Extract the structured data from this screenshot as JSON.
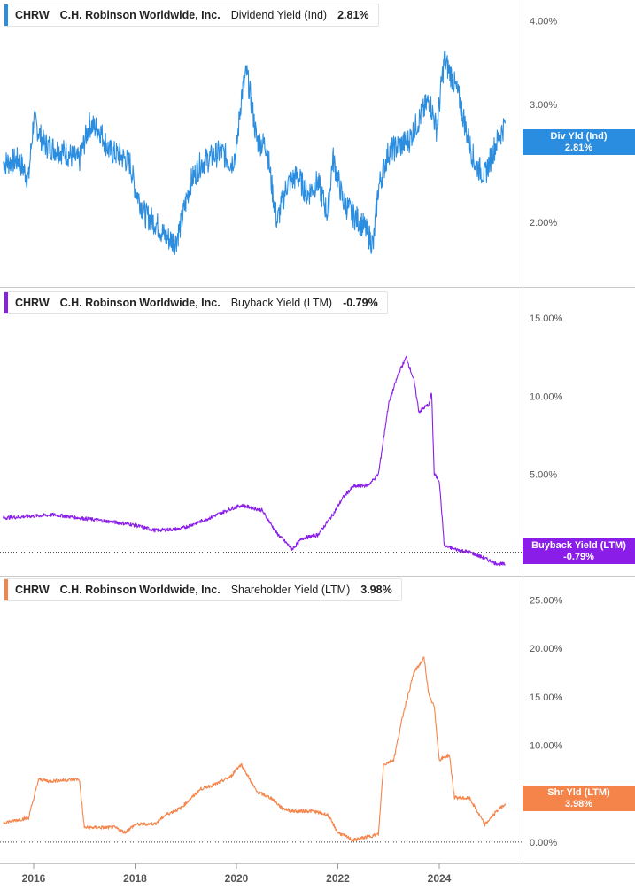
{
  "x_axis": {
    "ticks": [
      "2016",
      "2018",
      "2020",
      "2022",
      "2024"
    ]
  },
  "panels": [
    {
      "ticker": "CHRW",
      "company": "C.H. Robinson Worldwide, Inc.",
      "metric": "Dividend Yield (Ind)",
      "value_label": "2.81%",
      "callout_line1": "Div Yld (Ind)",
      "callout_line2": "2.81%",
      "y_ticks": [
        "4.00%",
        "3.00%",
        "2.00%"
      ],
      "color": "#2a8de0"
    },
    {
      "ticker": "CHRW",
      "company": "C.H. Robinson Worldwide, Inc.",
      "metric": "Buyback Yield (LTM)",
      "value_label": "-0.79%",
      "callout_line1": "Buyback Yield (LTM)",
      "callout_line2": "-0.79%",
      "y_ticks": [
        "15.00%",
        "10.00%",
        "5.00%",
        "0.00%"
      ],
      "color": "#8a1ee8"
    },
    {
      "ticker": "CHRW",
      "company": "C.H. Robinson Worldwide, Inc.",
      "metric": "Shareholder Yield (LTM)",
      "value_label": "3.98%",
      "callout_line1": "Shr Yld (LTM)",
      "callout_line2": "3.98%",
      "y_ticks": [
        "25.00%",
        "20.00%",
        "15.00%",
        "10.00%",
        "5.00%",
        "0.00%"
      ],
      "color": "#f5844a"
    }
  ],
  "chart_data": [
    {
      "type": "line",
      "title": "Dividend Yield (Ind)",
      "series": [
        {
          "name": "CHRW C.H. Robinson Worldwide, Inc.",
          "x": [
            2015.4,
            2015.7,
            2015.9,
            2016.0,
            2016.2,
            2016.4,
            2016.6,
            2016.9,
            2017.1,
            2017.3,
            2017.5,
            2017.7,
            2017.9,
            2018.0,
            2018.2,
            2018.4,
            2018.6,
            2018.8,
            2018.9,
            2019.1,
            2019.3,
            2019.5,
            2019.7,
            2019.9,
            2020.0,
            2020.1,
            2020.2,
            2020.4,
            2020.6,
            2020.7,
            2020.8,
            2021.0,
            2021.2,
            2021.4,
            2021.6,
            2021.8,
            2021.9,
            2022.1,
            2022.3,
            2022.5,
            2022.7,
            2022.8,
            2023.0,
            2023.2,
            2023.4,
            2023.6,
            2023.8,
            2023.95,
            2024.1,
            2024.25,
            2024.4,
            2024.55,
            2024.7,
            2024.9,
            2025.1,
            2025.3
          ],
          "y": [
            2.45,
            2.48,
            2.32,
            2.85,
            2.62,
            2.58,
            2.55,
            2.47,
            2.8,
            2.75,
            2.55,
            2.52,
            2.45,
            2.25,
            2.05,
            2.0,
            1.9,
            1.87,
            1.98,
            2.3,
            2.45,
            2.5,
            2.55,
            2.45,
            2.55,
            3.1,
            3.35,
            2.65,
            2.6,
            2.25,
            2.0,
            2.28,
            2.35,
            2.2,
            2.3,
            2.05,
            2.5,
            2.15,
            2.05,
            1.98,
            1.85,
            2.25,
            2.55,
            2.6,
            2.65,
            2.85,
            3.05,
            2.75,
            3.5,
            3.3,
            3.05,
            2.7,
            2.45,
            2.35,
            2.6,
            2.81
          ]
        }
      ],
      "ylim": [
        1.6,
        4.3
      ],
      "yscale": "log",
      "x_ticks": [
        "2016",
        "2018",
        "2020",
        "2022",
        "2024"
      ],
      "y_ticks": [
        "4.00%",
        "3.00%",
        "2.00%"
      ]
    },
    {
      "type": "line",
      "title": "Buyback Yield (LTM)",
      "series": [
        {
          "name": "CHRW C.H. Robinson Worldwide, Inc.",
          "x": [
            2015.4,
            2015.9,
            2016.4,
            2016.9,
            2017.4,
            2017.9,
            2018.4,
            2018.9,
            2019.4,
            2019.9,
            2020.1,
            2020.5,
            2020.8,
            2021.1,
            2021.3,
            2021.6,
            2021.9,
            2022.1,
            2022.3,
            2022.6,
            2022.8,
            2023.0,
            2023.2,
            2023.35,
            2023.5,
            2023.6,
            2023.8,
            2023.85,
            2023.9,
            2024.0,
            2024.1,
            2024.3,
            2024.6,
            2024.9,
            2025.1,
            2025.3
          ],
          "y": [
            2.2,
            2.3,
            2.4,
            2.2,
            2.0,
            1.8,
            1.4,
            1.5,
            2.1,
            2.8,
            3.0,
            2.7,
            1.2,
            0.2,
            0.9,
            1.1,
            2.4,
            3.5,
            4.2,
            4.3,
            5.0,
            9.5,
            11.5,
            12.5,
            11.0,
            9.0,
            9.5,
            10.2,
            5.0,
            4.6,
            0.4,
            0.2,
            0.0,
            -0.4,
            -0.7,
            -0.79
          ]
        }
      ],
      "ylim": [
        -1.5,
        17.0
      ],
      "x_ticks": [
        "2016",
        "2018",
        "2020",
        "2022",
        "2024"
      ],
      "y_ticks": [
        "15.00%",
        "10.00%",
        "5.00%",
        "0.00%"
      ]
    },
    {
      "type": "line",
      "title": "Shareholder Yield (LTM)",
      "series": [
        {
          "name": "CHRW C.H. Robinson Worldwide, Inc.",
          "x": [
            2015.4,
            2015.9,
            2016.1,
            2016.3,
            2016.9,
            2017.0,
            2017.6,
            2017.8,
            2018.0,
            2018.4,
            2018.6,
            2018.9,
            2019.3,
            2019.6,
            2019.9,
            2020.0,
            2020.1,
            2020.4,
            2020.7,
            2020.9,
            2021.1,
            2021.5,
            2021.8,
            2022.0,
            2022.3,
            2022.8,
            2022.9,
            2023.1,
            2023.3,
            2023.5,
            2023.7,
            2023.8,
            2023.9,
            2024.0,
            2024.2,
            2024.3,
            2024.6,
            2024.9,
            2025.1,
            2025.3
          ],
          "y": [
            2.0,
            2.5,
            6.5,
            6.3,
            6.5,
            1.5,
            1.5,
            1.0,
            1.8,
            1.9,
            2.8,
            3.5,
            5.5,
            6.0,
            6.8,
            7.6,
            8.0,
            5.2,
            4.5,
            3.5,
            3.2,
            3.2,
            2.8,
            1.0,
            0.2,
            0.8,
            8.0,
            8.5,
            13.5,
            17.5,
            19.0,
            15.0,
            14.0,
            8.5,
            9.0,
            4.6,
            4.5,
            1.8,
            3.0,
            3.98
          ]
        }
      ],
      "ylim": [
        -2.2,
        27.5
      ],
      "x_ticks": [
        "2016",
        "2018",
        "2020",
        "2022",
        "2024"
      ],
      "y_ticks": [
        "25.00%",
        "20.00%",
        "15.00%",
        "10.00%",
        "5.00%",
        "0.00%"
      ]
    }
  ]
}
